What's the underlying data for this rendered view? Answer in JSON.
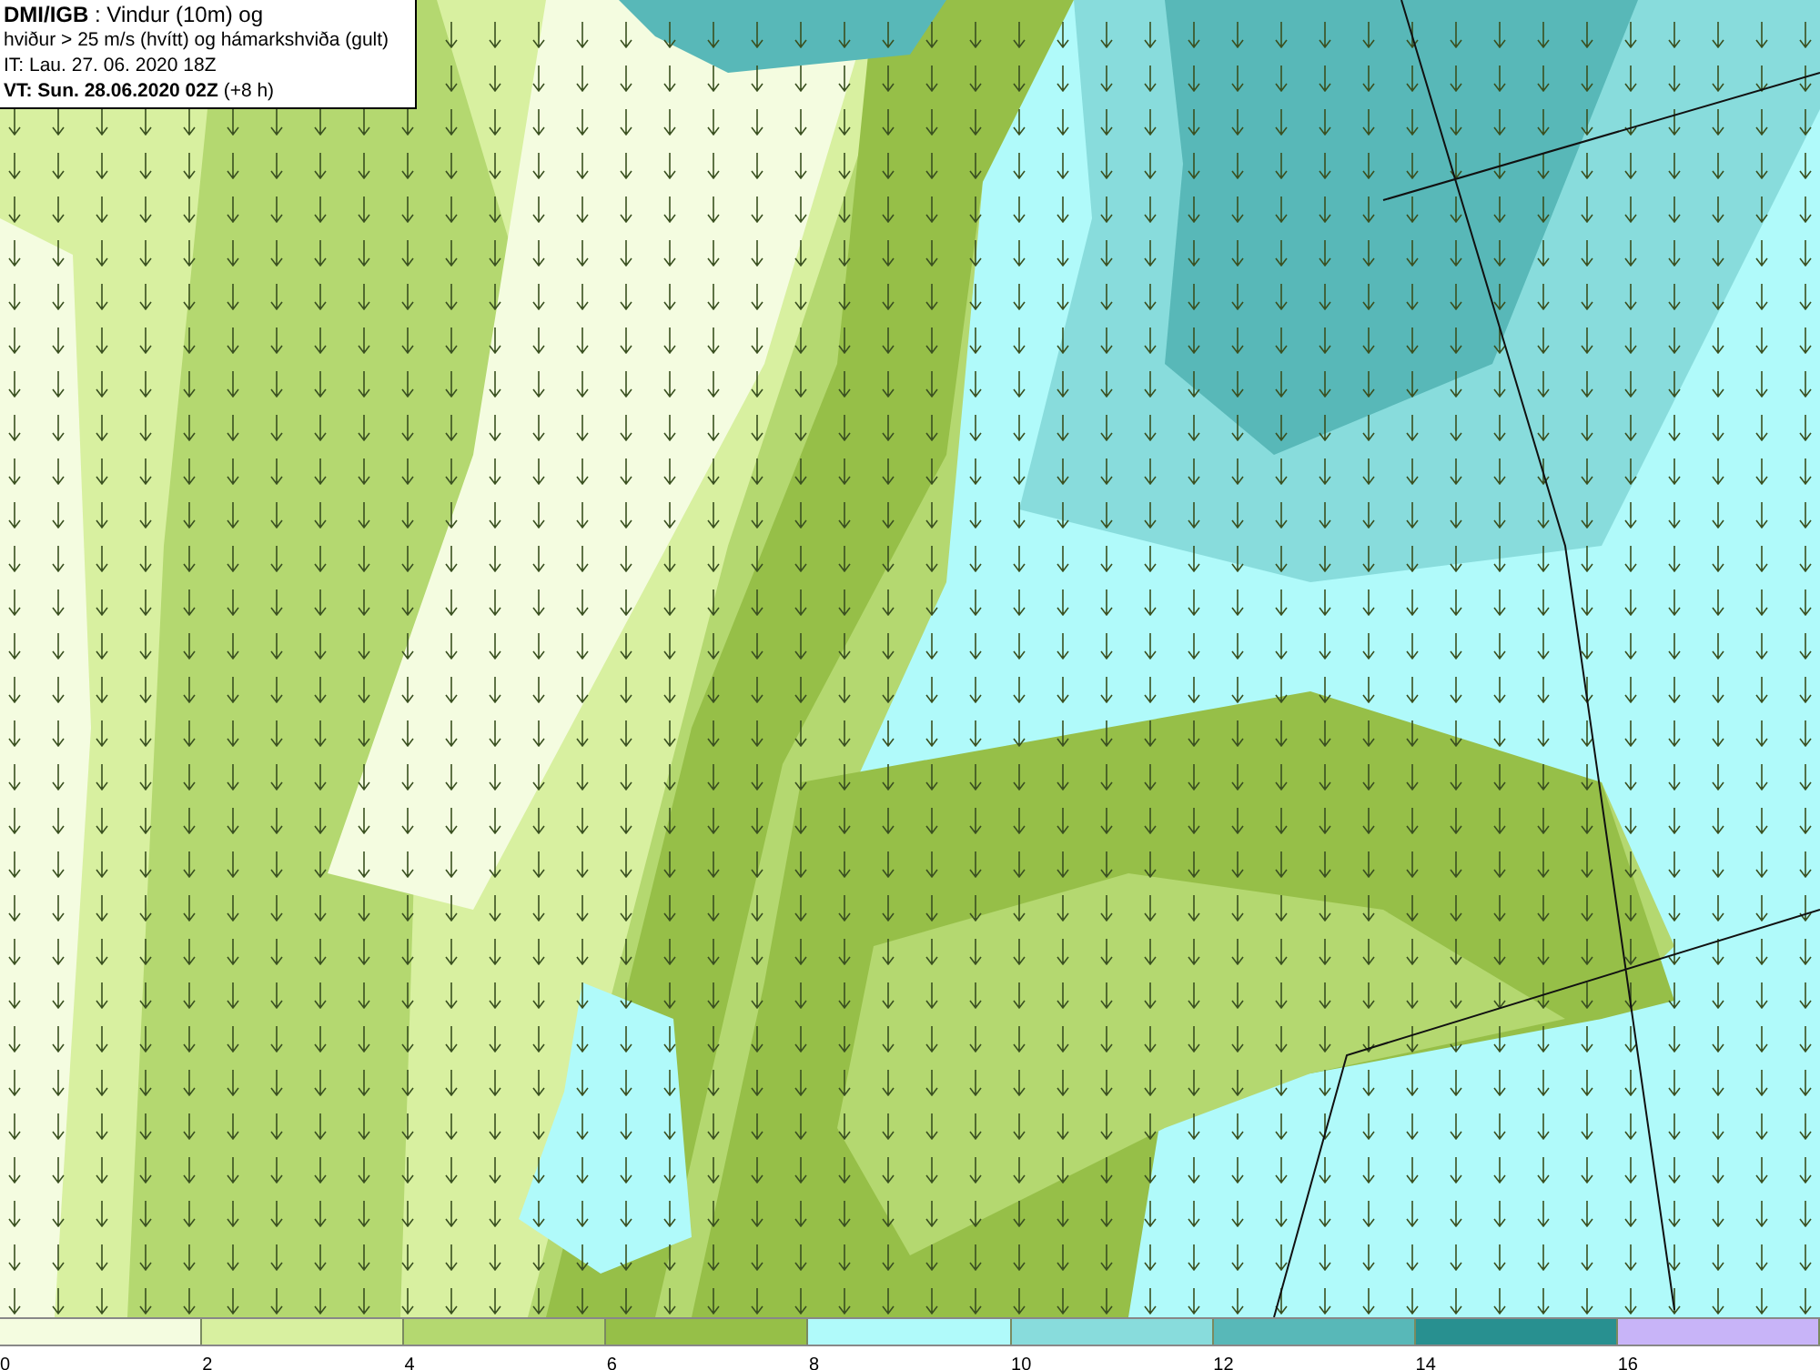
{
  "header": {
    "lines": [
      "**DMI/IGB** : Vindur (10m) og",
      "hviður > 25 m/s (hvítt) og hámarkshviða (gult)",
      "IT: Lau. 27. 06. 2020 18Z",
      "**VT: Sun. 28.06.2020 02Z** (+8 h)"
    ]
  },
  "legend": {
    "segments": [
      {
        "color": "#f4fce0",
        "label": "0"
      },
      {
        "color": "#d8f0a0",
        "label": "2"
      },
      {
        "color": "#b4d870",
        "label": "4"
      },
      {
        "color": "#96bf48",
        "label": "6"
      },
      {
        "color": "#b0fafa",
        "label": "8"
      },
      {
        "color": "#88dcdc",
        "label": "10"
      },
      {
        "color": "#58b8b8",
        "label": "12"
      },
      {
        "color": "#289090",
        "label": "14"
      },
      {
        "color": "#c8b4f8",
        "label": "16"
      }
    ]
  }
}
